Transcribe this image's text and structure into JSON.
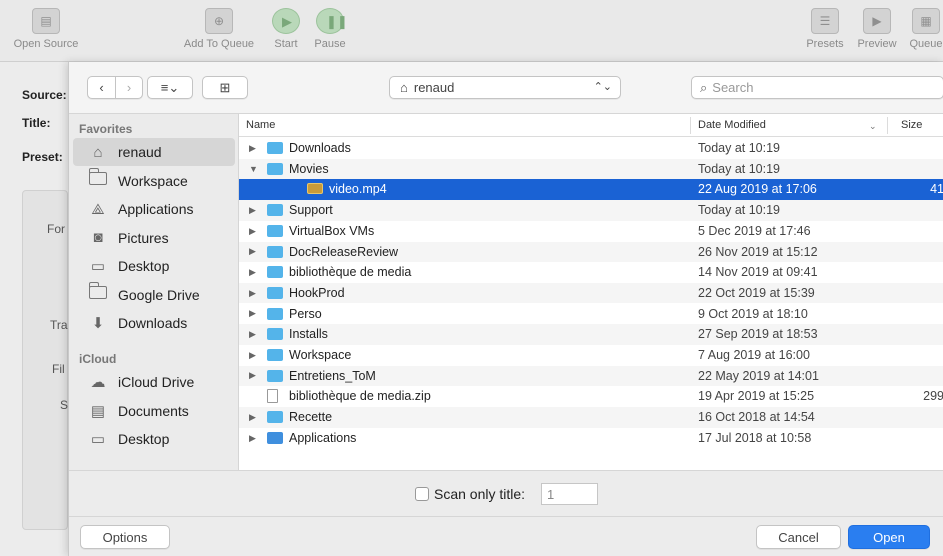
{
  "app_toolbar": {
    "open_source": "Open Source",
    "add_to_queue": "Add To Queue",
    "start": "Start",
    "pause": "Pause",
    "presets": "Presets",
    "preview": "Preview",
    "queue": "Queue"
  },
  "app_form": {
    "source_label": "Source:",
    "title_label": "Title:",
    "preset_label": "Preset:",
    "partial_labels": [
      "For",
      "Tra",
      "Fil",
      "S"
    ]
  },
  "dialog": {
    "location": "renaud",
    "search_placeholder": "Search",
    "sidebar": {
      "favorites_header": "Favorites",
      "favorites": [
        {
          "label": "renaud",
          "icon": "home-icon"
        },
        {
          "label": "Workspace",
          "icon": "folder-icon"
        },
        {
          "label": "Applications",
          "icon": "applications-icon"
        },
        {
          "label": "Pictures",
          "icon": "camera-icon"
        },
        {
          "label": "Desktop",
          "icon": "desktop-icon"
        },
        {
          "label": "Google Drive",
          "icon": "folder-icon"
        },
        {
          "label": "Downloads",
          "icon": "download-icon"
        }
      ],
      "icloud_header": "iCloud",
      "icloud": [
        {
          "label": "iCloud Drive",
          "icon": "cloud-icon"
        },
        {
          "label": "Documents",
          "icon": "documents-icon"
        },
        {
          "label": "Desktop",
          "icon": "desktop-icon"
        }
      ]
    },
    "columns": {
      "name": "Name",
      "date_modified": "Date Modified",
      "size": "Size"
    },
    "files": [
      {
        "name": "Downloads",
        "date": "Today at 10:19",
        "size": "",
        "type": "folder-download",
        "expand": "collapsed",
        "indent": 0
      },
      {
        "name": "Movies",
        "date": "Today at 10:19",
        "size": "",
        "type": "folder-movies",
        "expand": "expanded",
        "indent": 0
      },
      {
        "name": "video.mp4",
        "date": "22 Aug 2019 at 17:06",
        "size": "41",
        "type": "video",
        "expand": "none",
        "indent": 1,
        "selected": true
      },
      {
        "name": "Support",
        "date": "Today at 10:19",
        "size": "",
        "type": "folder",
        "expand": "collapsed",
        "indent": 0
      },
      {
        "name": "VirtualBox VMs",
        "date": "5 Dec 2019 at 17:46",
        "size": "",
        "type": "folder",
        "expand": "collapsed",
        "indent": 0
      },
      {
        "name": "DocReleaseReview",
        "date": "26 Nov 2019 at 15:12",
        "size": "",
        "type": "folder",
        "expand": "collapsed",
        "indent": 0
      },
      {
        "name": "bibliothèque de media",
        "date": "14 Nov 2019 at 09:41",
        "size": "",
        "type": "folder",
        "expand": "collapsed",
        "indent": 0
      },
      {
        "name": "HookProd",
        "date": "22 Oct 2019 at 15:39",
        "size": "",
        "type": "folder",
        "expand": "collapsed",
        "indent": 0
      },
      {
        "name": "Perso",
        "date": "9 Oct 2019 at 18:10",
        "size": "",
        "type": "folder",
        "expand": "collapsed",
        "indent": 0
      },
      {
        "name": "Installs",
        "date": "27 Sep 2019 at 18:53",
        "size": "",
        "type": "folder",
        "expand": "collapsed",
        "indent": 0
      },
      {
        "name": "Workspace",
        "date": "7 Aug 2019 at 16:00",
        "size": "",
        "type": "folder",
        "expand": "collapsed",
        "indent": 0
      },
      {
        "name": "Entretiens_ToM",
        "date": "22 May 2019 at 14:01",
        "size": "",
        "type": "folder",
        "expand": "collapsed",
        "indent": 0
      },
      {
        "name": "bibliothèque de media.zip",
        "date": "19 Apr 2019 at 15:25",
        "size": "299",
        "type": "zip",
        "expand": "none",
        "indent": 0
      },
      {
        "name": "Recette",
        "date": "16 Oct 2018 at 14:54",
        "size": "",
        "type": "folder",
        "expand": "collapsed",
        "indent": 0
      },
      {
        "name": "Applications",
        "date": "17 Jul 2018 at 10:58",
        "size": "",
        "type": "folder-app",
        "expand": "collapsed",
        "indent": 0
      }
    ],
    "scan_only_title": {
      "label": "Scan only title:",
      "value": "1",
      "checked": false
    },
    "buttons": {
      "options": "Options",
      "cancel": "Cancel",
      "open": "Open"
    },
    "colors": {
      "selection": "#1a62d4",
      "primary_button": "#2a7ef0",
      "folder": "#54b4ea"
    }
  }
}
